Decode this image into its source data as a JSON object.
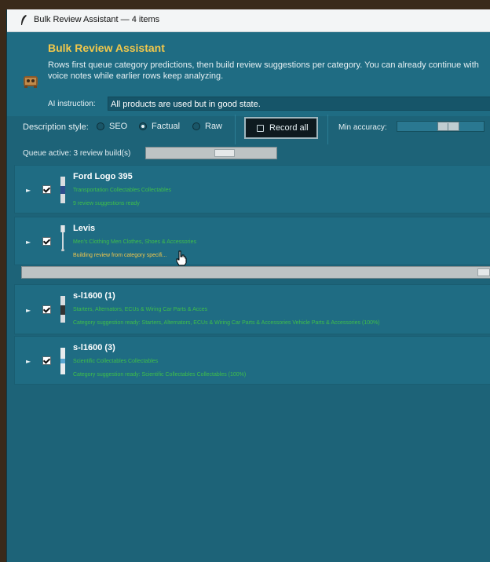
{
  "window": {
    "title": "Bulk Review Assistant — 4 items"
  },
  "header": {
    "title": "Bulk Review Assistant",
    "description": "Rows first queue category predictions, then build review suggestions per category. You can already continue with voice notes while earlier rows keep analyzing.",
    "ai_instruction_label": "AI instruction:",
    "ai_instruction_value": "All products are used but in good state."
  },
  "controls": {
    "description_style_label": "Description style:",
    "styles": [
      {
        "label": "SEO",
        "selected": false
      },
      {
        "label": "Factual",
        "selected": true
      },
      {
        "label": "Raw",
        "selected": false
      }
    ],
    "record_all_label": "Record all",
    "min_accuracy_label": "Min accuracy:",
    "min_accuracy_value": 0.62
  },
  "queue": {
    "label": "Queue active: 3 review build(s)",
    "progress": 0.62
  },
  "items": [
    {
      "name": "Ford Logo 395",
      "category": "Transportation Collectables Collectables",
      "status": "9 review suggestions ready",
      "checked": true,
      "busy": false
    },
    {
      "name": "Levis",
      "category": "Men's Clothing Men Clothes, Shoes & Accessories",
      "status": "Building review from category specifi...",
      "checked": true,
      "busy": true,
      "progress": 0.98
    },
    {
      "name": "s-l1600 (1)",
      "category": "Starters, Alternators, ECUs & Wiring Car Parts & Acces",
      "status": "Category suggestion ready: Starters, Alternators, ECUs & Wiring Car Parts & Accessories Vehicle Parts & Accessories (100%)",
      "checked": true,
      "busy": false
    },
    {
      "name": "s-l1600 (3)",
      "category": "Scientific Collectables Collectables",
      "status": "Category suggestion ready: Scientific Collectables Collectables (100%)",
      "checked": true,
      "busy": false
    }
  ],
  "colors": {
    "accent": "#f2c84b",
    "status_ok": "#3fbf4a",
    "background": "#1d6378"
  }
}
